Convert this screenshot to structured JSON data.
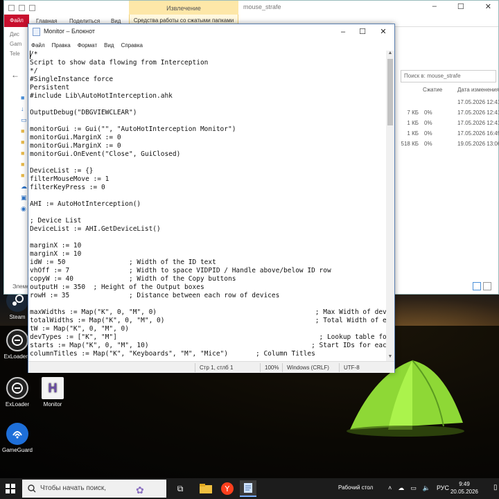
{
  "explorer": {
    "context_tab": "Извлечение",
    "title": "mouse_strafe",
    "tabs": {
      "file": "Файл",
      "home": "Главная",
      "share": "Поделиться",
      "view": "Вид",
      "compressed_tools": "Средства работы со сжатыми папками"
    },
    "left_items": [
      "Дис",
      "Gam",
      "Tele"
    ],
    "search_placeholder": "Поиск в: mouse_strafe",
    "columns": {
      "compression": "Сжатие",
      "date": "Дата изменения"
    },
    "rows": [
      {
        "size": "",
        "ratio": "",
        "date": "17.05.2026 12:41"
      },
      {
        "size": "7 КБ",
        "ratio": "0%",
        "date": "17.05.2026 12:41"
      },
      {
        "size": "1 КБ",
        "ratio": "0%",
        "date": "17.05.2026 12:41"
      },
      {
        "size": "1 КБ",
        "ratio": "0%",
        "date": "17.05.2026 16:49"
      },
      {
        "size": "518 КБ",
        "ratio": "0%",
        "date": "19.05.2026 13:06"
      }
    ],
    "status": "Элемен"
  },
  "notepad": {
    "title": "Monitor – Блокнот",
    "menu": [
      "Файл",
      "Правка",
      "Формат",
      "Вид",
      "Справка"
    ],
    "lines": [
      "/*",
      "Script to show data flowing from Interception",
      "*/",
      "#SingleInstance force",
      "Persistent",
      "#include Lib\\AutoHotInterception.ahk",
      "",
      "OutputDebug(\"DBGVIEWCLEAR\")",
      "",
      "monitorGui := Gui(\"\", \"AutoHotInterception Monitor\")",
      "monitorGui.MarginX := 0",
      "monitorGui.MarginX := 0",
      "monitorGui.OnEvent(\"Close\", GuiClosed)",
      "",
      "DeviceList := {}",
      "filterMouseMove := 1",
      "filterKeyPress := 0",
      "",
      "AHI := AutoHotInterception()",
      "",
      "; Device List",
      "DeviceList := AHI.GetDeviceList()",
      "",
      "marginX := 10",
      "marginX := 10",
      "idW := 50                ; Width of the ID text",
      "vhOff := 7               ; Width to space VIDPID / Handle above/below ID row",
      "copyW := 40              ; Width of the Copy buttons",
      "outputH := 350  ; Height of the Output boxes",
      "rowH := 35               ; Distance between each row of devices",
      "",
      "maxWidths := Map(\"K\", 0, \"M\", 0)                                        ; Max Width of device entries",
      "totalWidths := Map(\"K\", 0, \"M\", 0)                                      ; Total Width of each column",
      "tW := Map(\"K\", 0, \"M\", 0)",
      "devTypes := [\"K\", \"M\"]                                                   ; Lookup table for",
      "starts := Map(\"K\", 0, \"M\", 10)                                         ; Start IDs for each device",
      "columnTitles := Map(\"K\", \"Keyboards\", \"M\", \"Mice\")       ; Column Titles"
    ],
    "status": {
      "position": "Стр 1, стлб 1",
      "zoom": "100%",
      "line_endings": "Windows (CRLF)",
      "encoding": "UTF-8"
    }
  },
  "desktop_icons": [
    {
      "label": "Steam"
    },
    {
      "label": "ExLoader_"
    },
    {
      "label": "ExLoader"
    },
    {
      "label": "Monitor"
    },
    {
      "label": "GameGuard"
    }
  ],
  "taskbar": {
    "search_placeholder": "Чтобы начать поиск,",
    "desktop_label": "Рабочий стол",
    "language": "РУС",
    "time": "9:49",
    "date": "20.05.2026"
  }
}
